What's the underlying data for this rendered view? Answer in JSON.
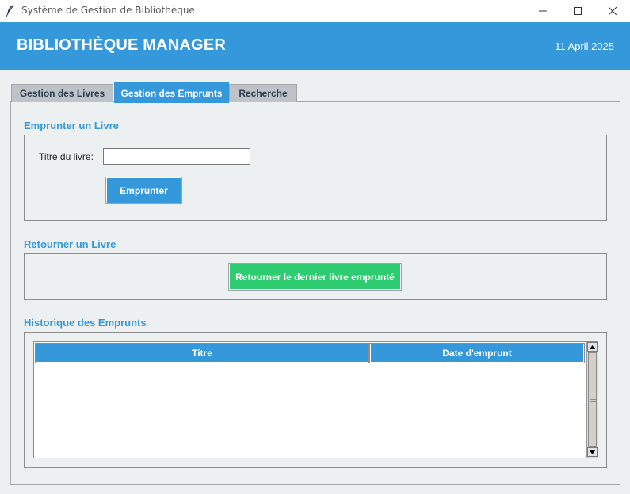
{
  "window": {
    "title": "Système de Gestion de Bibliothèque",
    "icon": "feather-icon"
  },
  "header": {
    "title": "BIBLIOTHÈQUE MANAGER",
    "date": "11 April 2025"
  },
  "tabs": [
    {
      "label": "Gestion des Livres",
      "active": false
    },
    {
      "label": "Gestion des Emprunts",
      "active": true
    },
    {
      "label": "Recherche",
      "active": false
    }
  ],
  "borrow": {
    "section_title": "Emprunter un Livre",
    "field_label": "Titre du livre:",
    "field_value": "",
    "button_label": "Emprunter"
  },
  "return": {
    "section_title": "Retourner un Livre",
    "button_label": "Retourner le dernier livre emprunté"
  },
  "history": {
    "section_title": "Historique des Emprunts",
    "columns": [
      "Titre",
      "Date d'emprunt"
    ],
    "rows": []
  },
  "colors": {
    "primary": "#3498db",
    "success": "#2ecc71",
    "background": "#ecf0f1",
    "tab_inactive": "#bdc3c7"
  }
}
